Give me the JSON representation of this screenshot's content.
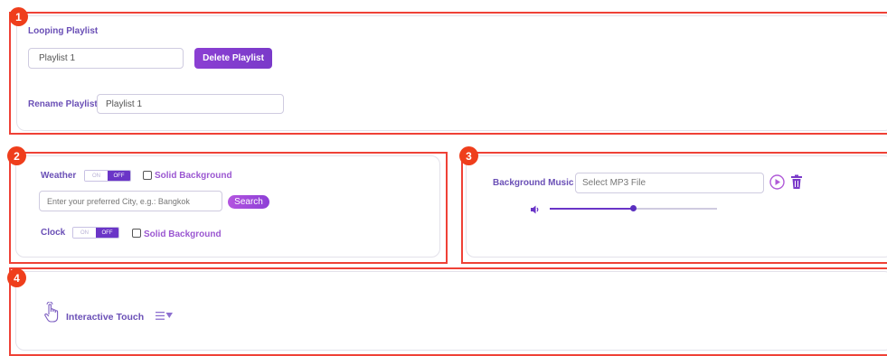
{
  "section1": {
    "badge": "1",
    "title": "Looping Playlist",
    "playlist_select_value": "Playlist 1",
    "delete_button": "Delete Playlist",
    "rename_label": "Rename Playlist",
    "rename_value": "Playlist 1"
  },
  "section2": {
    "badge": "2",
    "weather_label": "Weather",
    "weather_toggle": {
      "on": "ON",
      "off": "OFF",
      "state": "off"
    },
    "weather_solid_bg": "Solid Background",
    "city_placeholder": "Enter your preferred City, e.g.: Bangkok",
    "search_button": "Search",
    "clock_label": "Clock",
    "clock_toggle": {
      "on": "ON",
      "off": "OFF",
      "state": "off"
    },
    "clock_solid_bg": "Solid Background"
  },
  "section3": {
    "badge": "3",
    "music_label": "Background Music",
    "file_placeholder": "Select MP3 File",
    "volume_level": 0.5
  },
  "section4": {
    "badge": "4",
    "touch_label": "Interactive Touch"
  },
  "colors": {
    "frame": "#ef4136",
    "accent": "#6a35c7",
    "label": "#6a4fb6"
  },
  "icons": [
    "hand-touch-icon",
    "filter-menu-icon",
    "play-icon",
    "trash-icon",
    "volume-icon"
  ]
}
